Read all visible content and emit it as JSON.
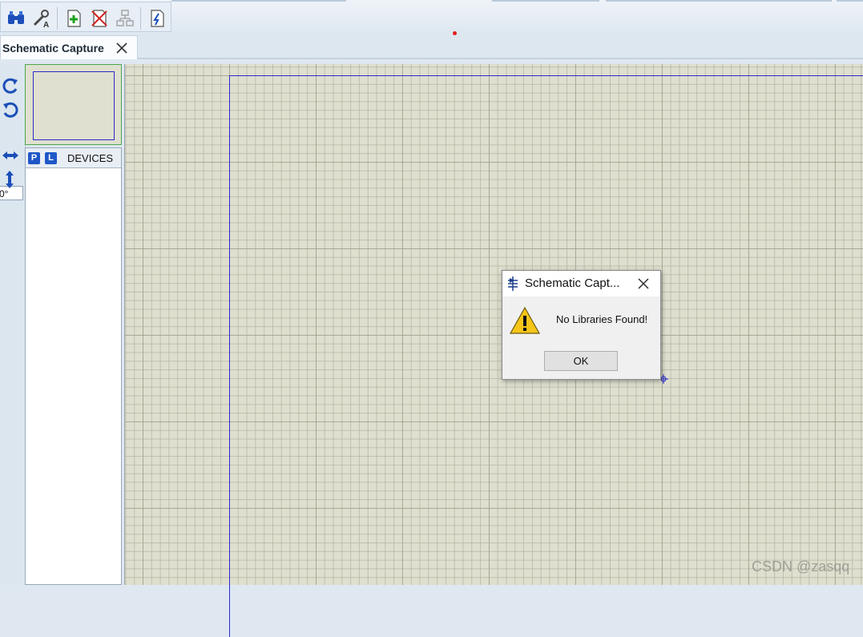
{
  "toolbar": {
    "buttons": [
      {
        "icon": "binoculars-icon"
      },
      {
        "icon": "wrench-label-icon"
      },
      {
        "icon": "new-sheet-icon"
      },
      {
        "icon": "remove-sheet-icon"
      },
      {
        "icon": "hierarchy-icon"
      },
      {
        "icon": "script-icon"
      }
    ]
  },
  "tab": {
    "title": "Schematic Capture"
  },
  "left_tools": {
    "rotation_value": "0°"
  },
  "devices_panel": {
    "pick_button": "P",
    "library_button": "L",
    "title": "DEVICES",
    "items": []
  },
  "dialog": {
    "title": "Schematic Capt...",
    "message": "No Libraries Found!",
    "ok_label": "OK"
  },
  "watermark": "CSDN @zasqq",
  "colors": {
    "canvas_bg": "#dfdfcf",
    "sheet_border": "#2a2ad0",
    "accent_blue": "#1f57c7",
    "overview_border": "#4ca64c"
  }
}
